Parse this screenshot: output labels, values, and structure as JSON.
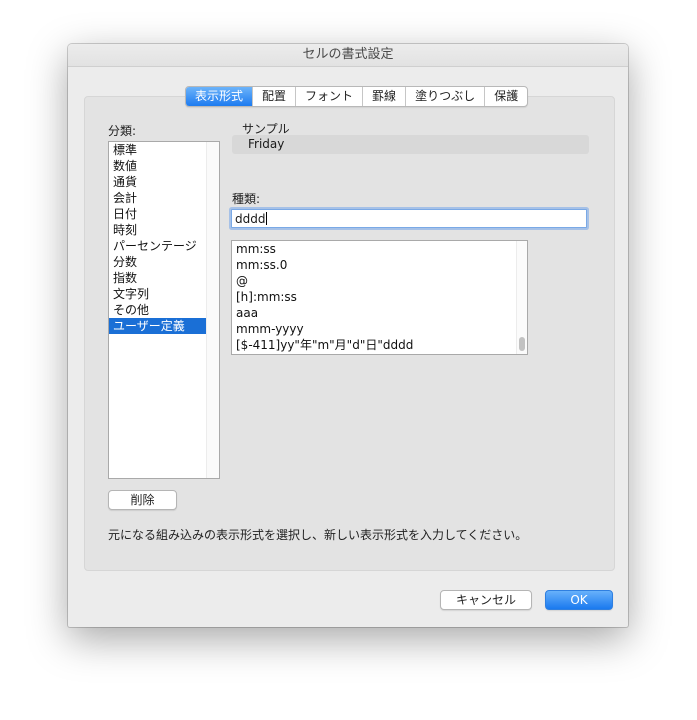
{
  "window": {
    "title": "セルの書式設定"
  },
  "tabs": [
    {
      "label": "表示形式",
      "active": true
    },
    {
      "label": "配置",
      "active": false
    },
    {
      "label": "フォント",
      "active": false
    },
    {
      "label": "罫線",
      "active": false
    },
    {
      "label": "塗りつぶし",
      "active": false
    },
    {
      "label": "保護",
      "active": false
    }
  ],
  "category": {
    "label": "分類:",
    "items": [
      "標準",
      "数値",
      "通貨",
      "会計",
      "日付",
      "時刻",
      "パーセンテージ",
      "分数",
      "指数",
      "文字列",
      "その他",
      "ユーザー定義"
    ],
    "selected": "ユーザー定義"
  },
  "sample": {
    "label": "サンプル",
    "value": "Friday"
  },
  "type": {
    "label": "種類:",
    "value": "dddd"
  },
  "formats": [
    "mm:ss",
    "mm:ss.0",
    "@",
    "[h]:mm:ss",
    "aaa",
    "mmm-yyyy",
    "[$-411]yy\"年\"m\"月\"d\"日\"dddd"
  ],
  "delete_label": "削除",
  "description": "元になる組み込みの表示形式を選択し、新しい表示形式を入力してください。",
  "buttons": {
    "cancel": "キャンセル",
    "ok": "OK"
  },
  "colors": {
    "accent": "#1a79ef",
    "selection": "#1a6fd6"
  }
}
